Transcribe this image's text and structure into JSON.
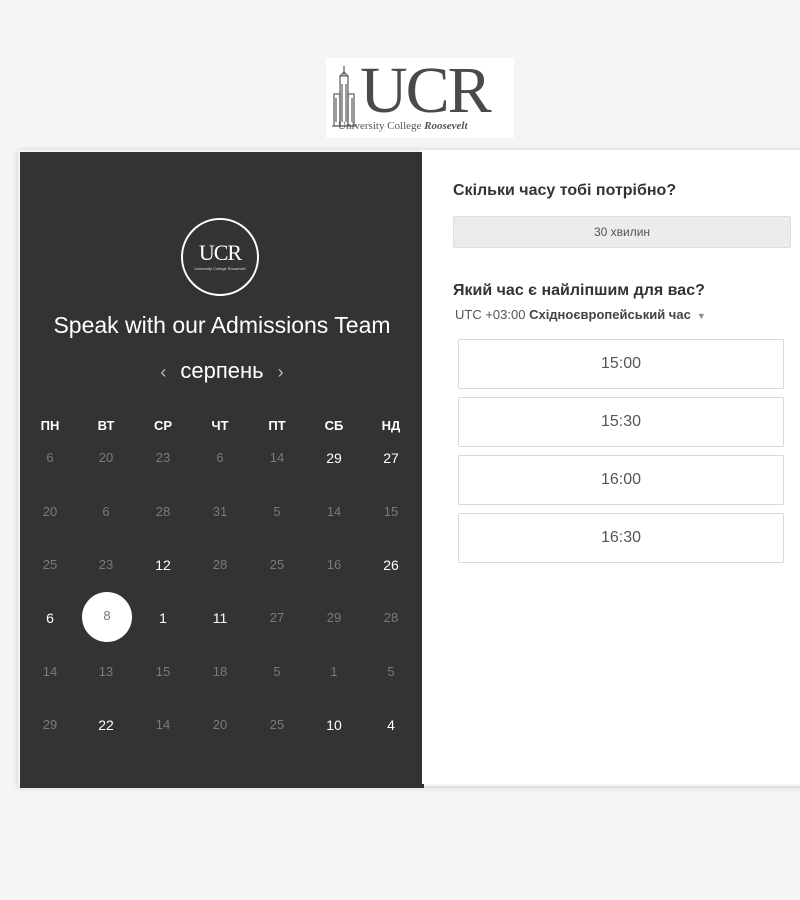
{
  "logo": {
    "letters": "UCR",
    "subtitle": "University College",
    "subtitle_em": "Roosevelt"
  },
  "badge": {
    "letters": "UCR",
    "small": "University College Roosevelt"
  },
  "headline": "Speak with our Admissions Team",
  "calendar": {
    "month": "серпень",
    "prev_icon": "chevron-left-icon",
    "next_icon": "chevron-right-icon",
    "weekdays": [
      "ПН",
      "ВТ",
      "СР",
      "ЧТ",
      "ПТ",
      "СБ",
      "НД"
    ],
    "rows": [
      [
        "6",
        "20",
        "23",
        "6",
        "14",
        "29",
        "27"
      ],
      [
        "20",
        "6",
        "28",
        "31",
        "5",
        "14",
        "15"
      ],
      [
        "25",
        "23",
        "12",
        "28",
        "25",
        "16",
        "26"
      ],
      [
        "6",
        "8",
        "1",
        "11",
        "27",
        "29",
        "28"
      ],
      [
        "14",
        "13",
        "15",
        "18",
        "5",
        "1",
        "5"
      ],
      [
        "29",
        "22",
        "14",
        "20",
        "25",
        "10",
        "4"
      ]
    ],
    "available": [
      [
        0,
        5
      ],
      [
        0,
        6
      ],
      [
        2,
        2
      ],
      [
        2,
        6
      ],
      [
        3,
        0
      ],
      [
        3,
        2
      ],
      [
        3,
        3
      ],
      [
        5,
        1
      ],
      [
        5,
        5
      ],
      [
        5,
        6
      ]
    ],
    "selected": [
      3,
      1
    ]
  },
  "duration": {
    "question": "Скільки часу тобі потрібно?",
    "value": "30 хвилин"
  },
  "time": {
    "question": "Який час є найліпшим для вас?",
    "timezone_offset": "UTC +03:00",
    "timezone_name": "Східноєвропейський час",
    "slots": [
      "15:00",
      "15:30",
      "16:00",
      "16:30"
    ]
  }
}
